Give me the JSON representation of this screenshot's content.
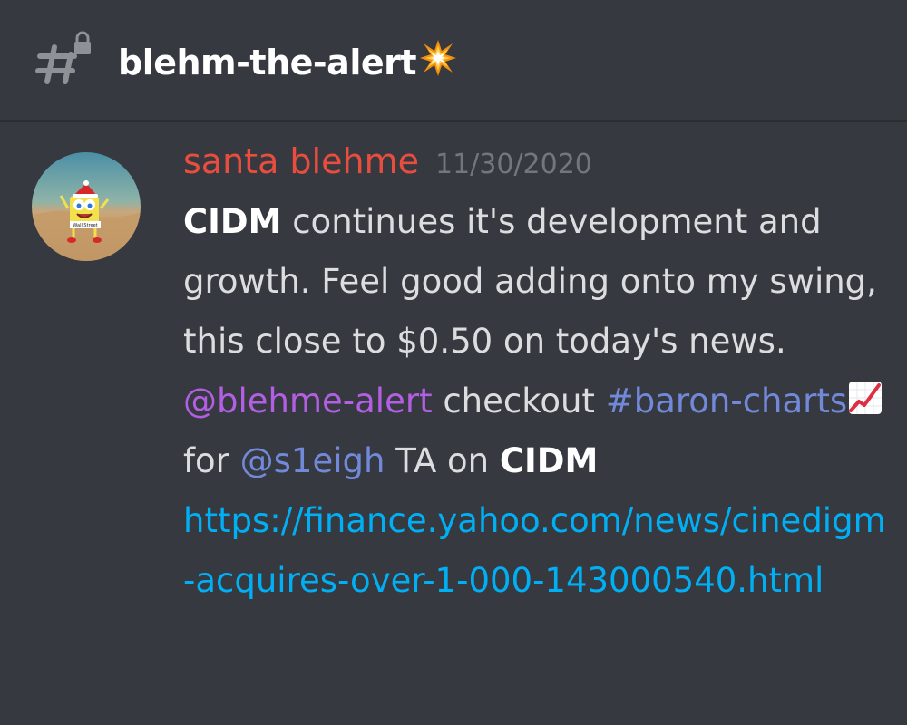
{
  "header": {
    "channel_name": "blehm-the-alert",
    "channel_icon": "locked-text-channel-icon",
    "channel_emoji": "collision-emoji"
  },
  "message": {
    "author": "santa blehme",
    "author_color": "#e84d3d",
    "timestamp": "11/30/2020",
    "avatar": "spongebob-santa-avatar",
    "line1_ticker": "CIDM",
    "line1_text": " continues it's development and growth. Feel good adding onto my swing, this close to $0.50 on today's news.",
    "mention_user": "@blehme-alert",
    "text_checkout": " checkout ",
    "mention_channel": "#baron-charts",
    "chart_emoji": "chart-increasing-emoji",
    "text_for": " for ",
    "mention_role": "@s1eigh",
    "text_ta_on": " TA on ",
    "ticker2": "CIDM",
    "link_url": "https://finance.yahoo.com/news/cinedigm-acquires-over-1-000-143000540.html"
  },
  "colors": {
    "background": "#36393f",
    "text": "#dcddde",
    "link": "#00aff4",
    "mention_user": "#b25fe3",
    "mention_channel": "#7289da",
    "timestamp": "#72767d"
  }
}
